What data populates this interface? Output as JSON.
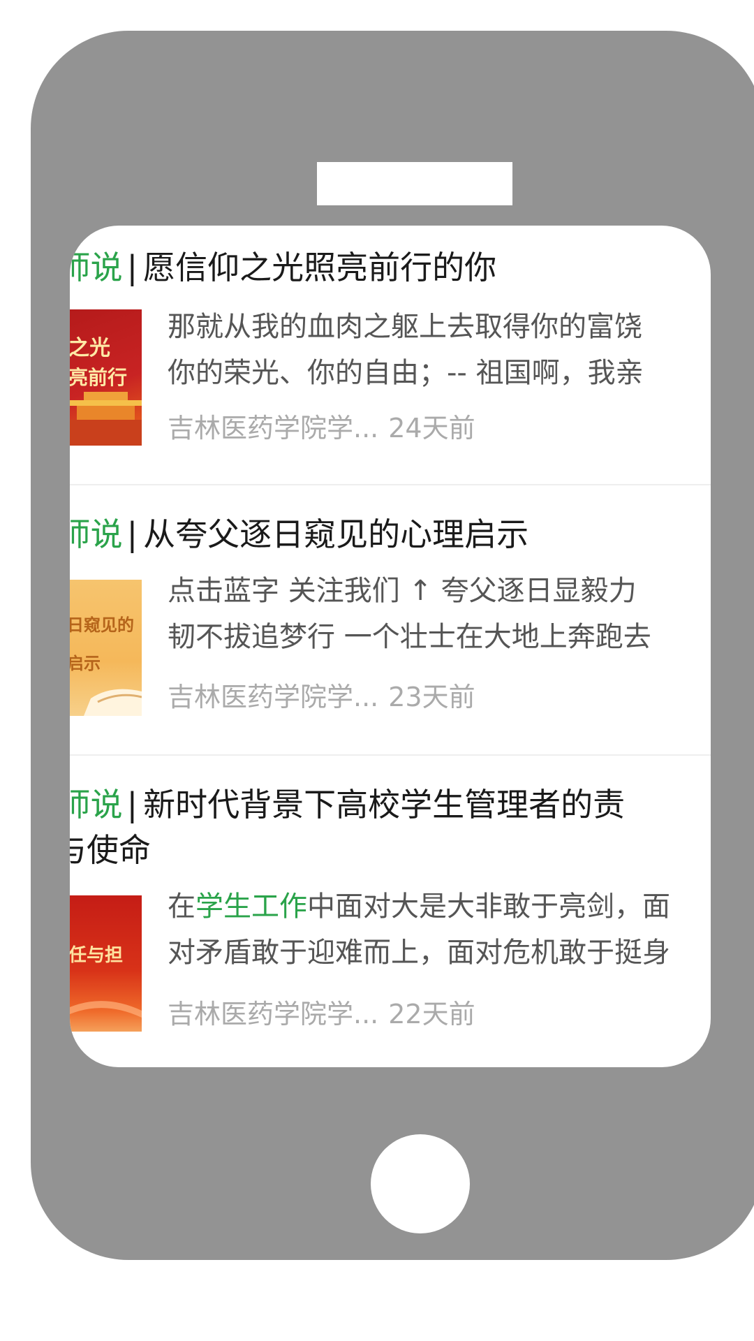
{
  "articles": [
    {
      "title_prefix": "I师说",
      "separator": "|",
      "title": "愿信仰之光照亮前行的你",
      "title_cont": "",
      "summary_line1": "那就从我的血肉之躯上去取得你的富饶",
      "summary_line2": "你的荣光、你的自由；-- 祖国啊，我亲",
      "thumb_text1": "之光",
      "thumb_text2": "亮前行",
      "source": "吉林医药学院学...",
      "time": "24天前"
    },
    {
      "title_prefix": "I师说",
      "separator": "|",
      "title": "从夸父逐日窥见的心理启示",
      "title_cont": "",
      "summary_line1": "点击蓝字 关注我们 ↑ 夸父逐日显毅力",
      "summary_line2": "韧不拔追梦行 一个壮士在大地上奔跑去",
      "thumb_text1": "日窥见的",
      "thumb_text2": "启示",
      "source": "吉林医药学院学...",
      "time": "23天前"
    },
    {
      "title_prefix": "I师说",
      "separator": "|",
      "title": "新时代背景下高校学生管理者的责",
      "title_cont": "与使命",
      "summary_pre": "在",
      "summary_highlight": "学生工作",
      "summary_post": "中面对大是大非敢于亮剑，面",
      "summary_line2": "对矛盾敢于迎难而上，面对危机敢于挺身",
      "thumb_text1": "任与担",
      "source": "吉林医药学院学...",
      "time": "22天前"
    }
  ],
  "colors": {
    "accent_green": "#2aa34a",
    "phone_gray": "#939393"
  }
}
